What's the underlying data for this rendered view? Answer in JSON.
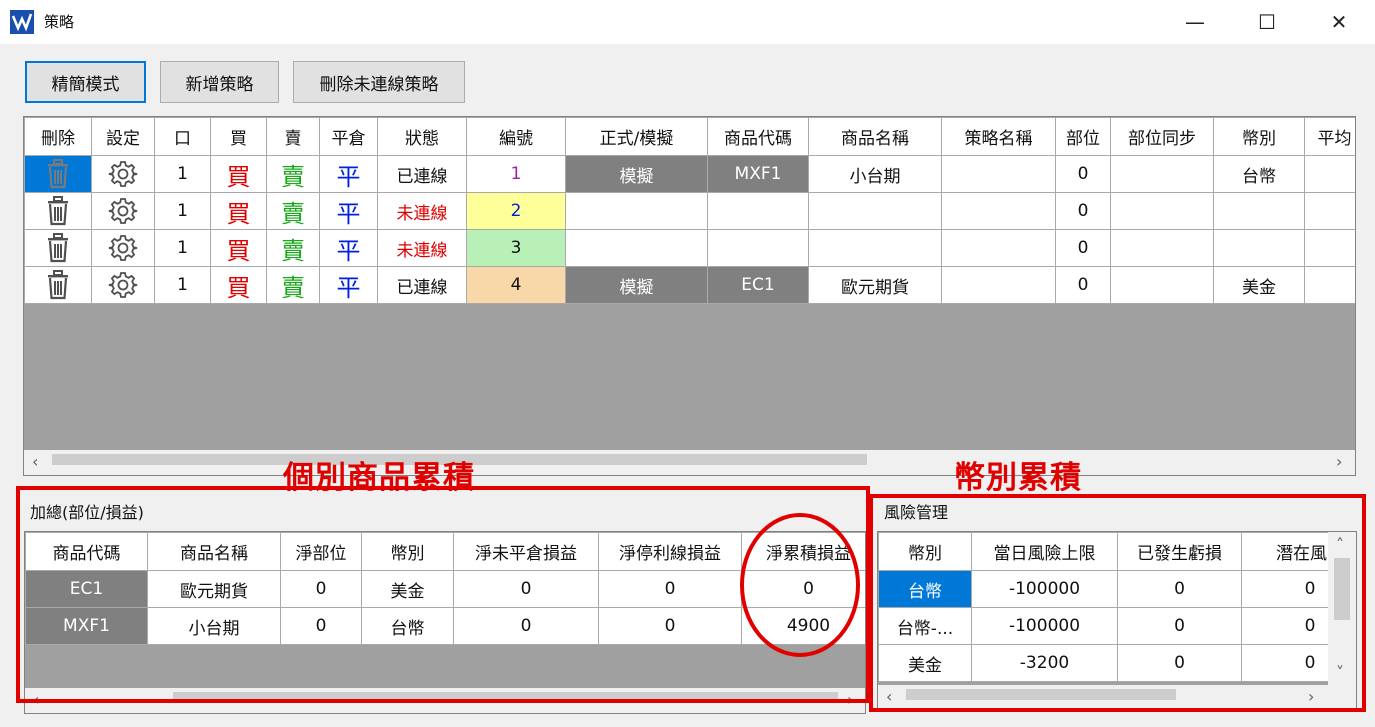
{
  "window": {
    "title": "策略",
    "min_icon": "minimize-icon",
    "max_icon": "maximize-icon",
    "close_icon": "close-icon",
    "min_glyph": "—",
    "max_glyph": "☐",
    "close_glyph": "✕"
  },
  "toolbar": {
    "simple_mode": "精簡模式",
    "add_strategy": "新增策略",
    "delete_disconnected": "刪除未連線策略"
  },
  "strategy_table": {
    "headers": [
      "刪除",
      "設定",
      "口",
      "買",
      "賣",
      "平倉",
      "狀態",
      "編號",
      "正式/模擬",
      "商品代碼",
      "商品名稱",
      "策略名稱",
      "部位",
      "部位同步",
      "幣別",
      "平均"
    ],
    "rows": [
      {
        "qty": "1",
        "buy": "買",
        "sell": "賣",
        "close": "平",
        "status": "已連線",
        "id": "1",
        "mode": "模擬",
        "code": "MXF1",
        "name": "小台期",
        "strategy_name": "",
        "position": "0",
        "pos_sync": "",
        "currency": "台幣",
        "avg": ""
      },
      {
        "qty": "1",
        "buy": "買",
        "sell": "賣",
        "close": "平",
        "status": "未連線",
        "id": "2",
        "mode": "",
        "code": "",
        "name": "",
        "strategy_name": "",
        "position": "0",
        "pos_sync": "",
        "currency": "",
        "avg": ""
      },
      {
        "qty": "1",
        "buy": "買",
        "sell": "賣",
        "close": "平",
        "status": "未連線",
        "id": "3",
        "mode": "",
        "code": "",
        "name": "",
        "strategy_name": "",
        "position": "0",
        "pos_sync": "",
        "currency": "",
        "avg": ""
      },
      {
        "qty": "1",
        "buy": "買",
        "sell": "賣",
        "close": "平",
        "status": "已連線",
        "id": "4",
        "mode": "模擬",
        "code": "EC1",
        "name": "歐元期貨",
        "strategy_name": "",
        "position": "0",
        "pos_sync": "",
        "currency": "美金",
        "avg": ""
      }
    ]
  },
  "annotations": {
    "left": "個別商品累積",
    "right": "幣別累積"
  },
  "summary": {
    "label": "加總(部位/損益)",
    "headers": [
      "商品代碼",
      "商品名稱",
      "淨部位",
      "幣別",
      "淨未平倉損益",
      "淨停利線損益",
      "淨累積損益"
    ],
    "rows": [
      {
        "code": "EC1",
        "name": "歐元期貨",
        "net_position": "0",
        "currency": "美金",
        "open_pl": "0",
        "stop_pl": "0",
        "cum_pl": "0"
      },
      {
        "code": "MXF1",
        "name": "小台期",
        "net_position": "0",
        "currency": "台幣",
        "open_pl": "0",
        "stop_pl": "0",
        "cum_pl": "4900"
      }
    ]
  },
  "risk": {
    "label": "風險管理",
    "headers": [
      "幣別",
      "當日風險上限",
      "已發生虧損",
      "潛在風險"
    ],
    "rows": [
      {
        "currency": "台幣",
        "limit": "-100000",
        "loss": "0",
        "potential": "0"
      },
      {
        "currency": "台幣-...",
        "limit": "-100000",
        "loss": "0",
        "potential": "0"
      },
      {
        "currency": "美金",
        "limit": "-3200",
        "loss": "0",
        "potential": "0"
      }
    ]
  },
  "colors": {
    "buy": "#e00000",
    "sell": "#18a818",
    "close": "#0020e0",
    "annotation": "#e00000",
    "selected": "#0078d7",
    "mode_cell": "#808080",
    "id_colors": [
      "#ffffff",
      "#ffff99",
      "#b8f0b8",
      "#f8d8a8"
    ]
  },
  "scroll_glyphs": {
    "left": "‹",
    "right": "›",
    "up": "˄",
    "down": "˅"
  }
}
